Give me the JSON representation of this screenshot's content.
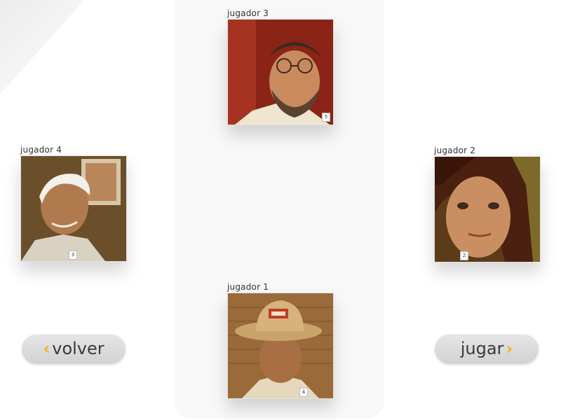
{
  "players": [
    {
      "id": "p3",
      "label": "jugador 3",
      "badge": "5",
      "photo": "bearded-man-glasses"
    },
    {
      "id": "p4",
      "label": "jugador 4",
      "badge": "3",
      "photo": "elderly-smiling-man"
    },
    {
      "id": "p2",
      "label": "jugador 2",
      "badge": "2",
      "photo": "young-woman"
    },
    {
      "id": "p1",
      "label": "jugador 1",
      "badge": "4",
      "photo": "man-straw-hat"
    }
  ],
  "buttons": {
    "back": {
      "label": "volver",
      "icon": "chevron-left-icon"
    },
    "play": {
      "label": "jugar",
      "icon": "chevron-right-icon"
    }
  },
  "colors": {
    "accent": "#f2b21b",
    "table": "#f8f8f8",
    "button": "#dcdcdc"
  }
}
